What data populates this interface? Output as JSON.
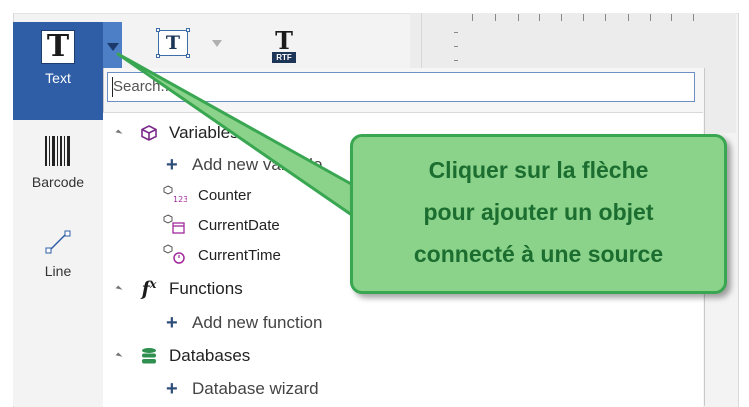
{
  "toolbox": {
    "items": [
      {
        "label": "Text",
        "icon": "text-tool-icon",
        "selected": true
      },
      {
        "label": "Barcode",
        "icon": "barcode-icon"
      },
      {
        "label": "Line",
        "icon": "line-icon"
      }
    ]
  },
  "toolbar": {
    "icons": [
      "text-box-icon",
      "rtf-icon"
    ],
    "rtf_label": "RTF"
  },
  "dropdown": {
    "search_placeholder": "Search..."
  },
  "tree": {
    "variables_label": "Variables",
    "add_variable_label": "Add new variable",
    "variables": [
      "Counter",
      "CurrentDate",
      "CurrentTime"
    ],
    "functions_label": "Functions",
    "add_function_label": "Add new function",
    "databases_label": "Databases",
    "database_wizard_label": "Database wizard"
  },
  "callout": {
    "line1": "Cliquer sur la flèche",
    "line2": "pour ajouter un objet",
    "line3": "connecté à une source"
  },
  "colors": {
    "selection": "#2f5ea7",
    "callout_fill": "#8bd38a",
    "callout_border": "#39a651",
    "callout_text": "#1b6e30"
  }
}
